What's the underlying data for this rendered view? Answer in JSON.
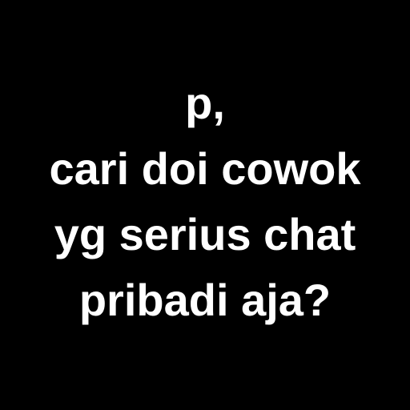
{
  "background_color": "#000000",
  "text_color": "#ffffff",
  "lines": [
    "p,",
    "cari doi cowok",
    "yg serius chat",
    "pribadi aja?"
  ]
}
